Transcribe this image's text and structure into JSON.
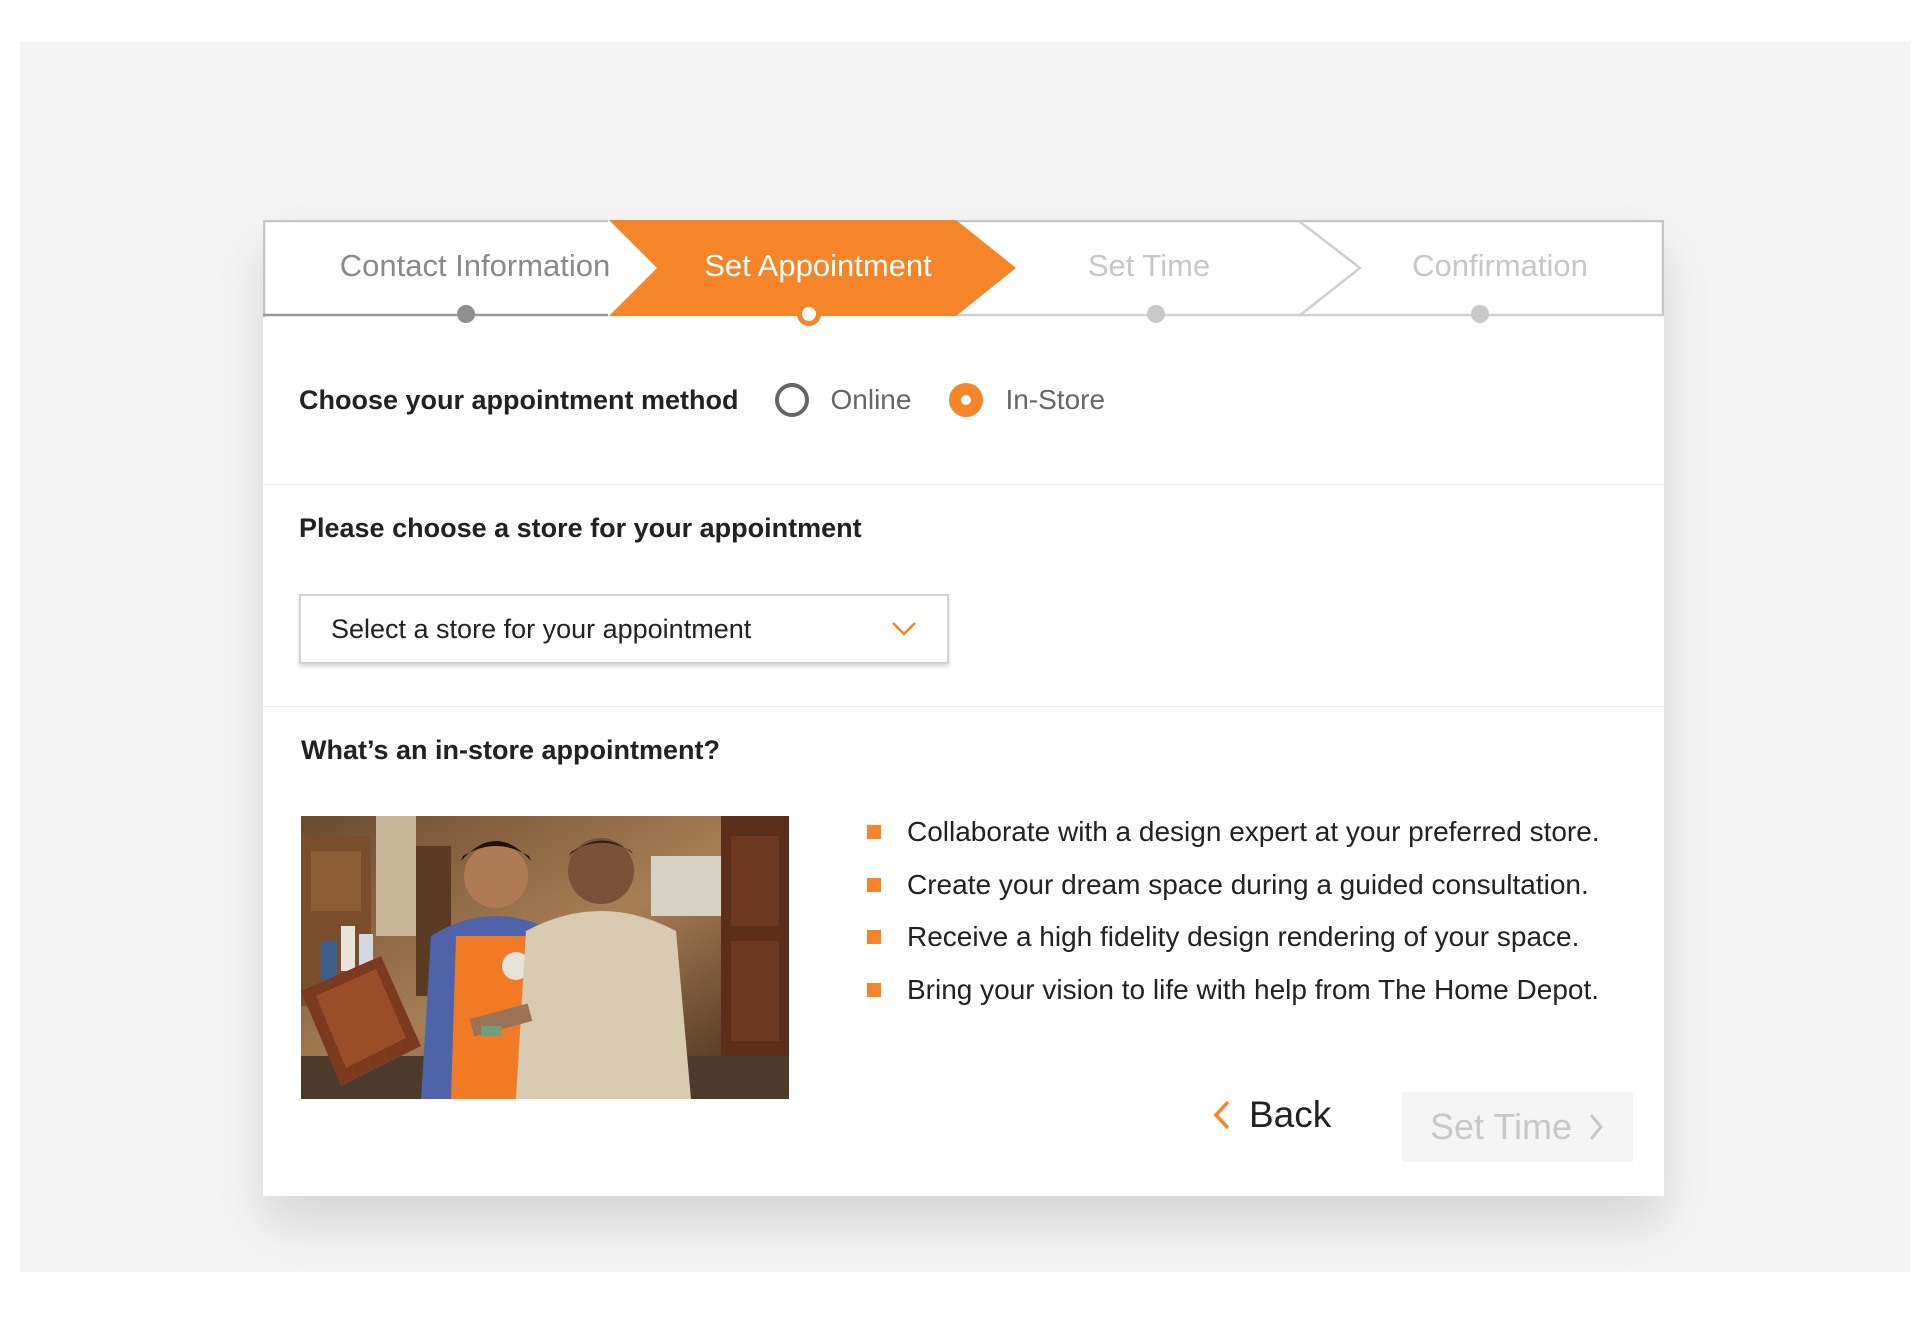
{
  "stepper": {
    "steps": [
      {
        "label": "Contact Information",
        "state": "completed"
      },
      {
        "label": "Set Appointment",
        "state": "active"
      },
      {
        "label": "Set Time",
        "state": "upcoming"
      },
      {
        "label": "Confirmation",
        "state": "upcoming"
      }
    ]
  },
  "method": {
    "label": "Choose your appointment method",
    "options": [
      {
        "label": "Online",
        "selected": false
      },
      {
        "label": "In-Store",
        "selected": true
      }
    ]
  },
  "store": {
    "title": "Please choose a store for your appointment",
    "select_value": "Select a store for your appointment",
    "chevron_icon": "chevron-down-icon"
  },
  "info": {
    "title": "What’s an in-store appointment?",
    "bullets": [
      "Collaborate with a design expert at your preferred store.",
      "Create your dream space during a guided consultation.",
      "Receive a high fidelity design rendering of your space.",
      "Bring your vision to life with help from The Home Depot."
    ]
  },
  "nav": {
    "back_label": "Back",
    "next_label": "Set Time",
    "next_enabled": false
  },
  "colors": {
    "accent": "#f68428",
    "backdrop": "#f3f4f3",
    "muted_text": "#c8c8c8",
    "completed_text": "#8a8a8a"
  }
}
